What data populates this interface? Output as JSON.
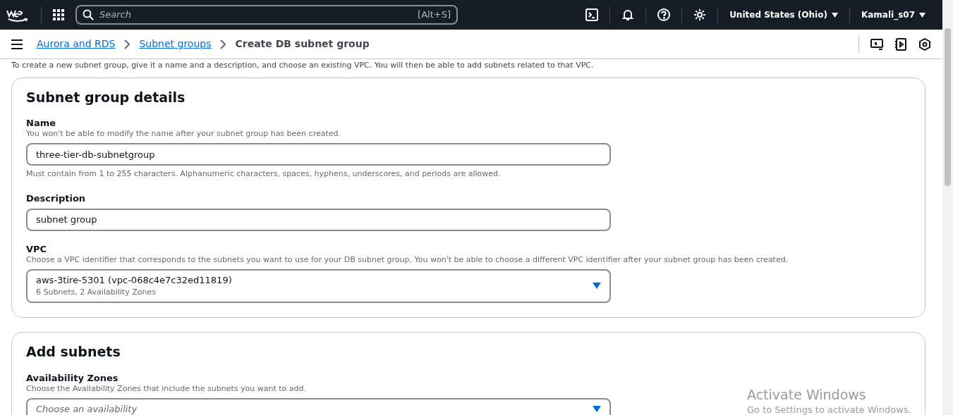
{
  "top_nav": {
    "search": {
      "placeholder": "Search",
      "shortcut": "[Alt+S]"
    },
    "region": "United States (Ohio)",
    "account": "Kamali_s07"
  },
  "breadcrumbs": [
    {
      "label": "Aurora and RDS",
      "kind": "link"
    },
    {
      "label": "Subnet groups",
      "kind": "link"
    },
    {
      "label": "Create DB subnet group",
      "kind": "current"
    }
  ],
  "intro": "To create a new subnet group, give it a name and a description, and choose an existing VPC. You will then be able to add subnets related to that VPC.",
  "sections": [
    {
      "title": "Subnet group details",
      "fields": [
        {
          "kind": "text",
          "label": "Name",
          "description": "You won't be able to modify the name after your subnet group has been created.",
          "value": "three-tier-db-subnetgroup",
          "constraint": "Must contain from 1 to 255 characters. Alphanumeric characters, spaces, hyphens, underscores, and periods are allowed."
        },
        {
          "kind": "text",
          "label": "Description",
          "value": "subnet group"
        },
        {
          "kind": "select",
          "label": "VPC",
          "description": "Choose a VPC identifier that corresponds to the subnets you want to use for your DB subnet group. You won't be able to choose a different VPC identifier after your subnet group has been created.",
          "value": "aws-3tire-5301 (vpc-068c4e7c32ed11819)",
          "secondary": "6 Subnets, 2 Availability Zones"
        }
      ]
    },
    {
      "title": "Add subnets",
      "fields": [
        {
          "kind": "select",
          "label": "Availability Zones",
          "description": "Choose the Availability Zones that include the subnets you want to add.",
          "placeholder": "Choose an availability"
        }
      ]
    }
  ],
  "os_notice": {
    "title": "Activate Windows",
    "message": "Go to Settings to activate Windows."
  }
}
